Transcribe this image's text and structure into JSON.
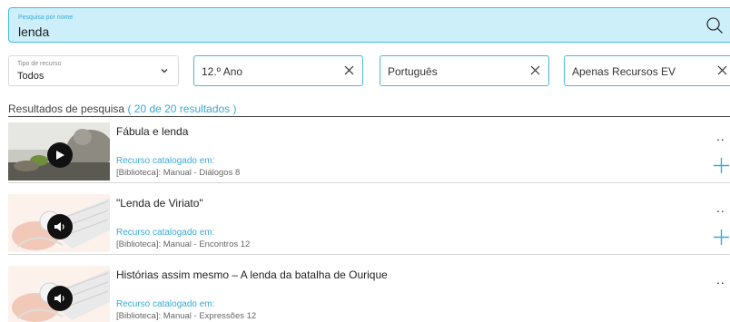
{
  "search": {
    "placeholder_label": "Pesquisa por nome",
    "value": "lenda",
    "icon": "search-icon"
  },
  "filters": {
    "type": {
      "label": "Tipo de recurso",
      "value": "Todos"
    },
    "chips": [
      {
        "label": "12.º Ano"
      },
      {
        "label": "Português"
      },
      {
        "label": "Apenas Recursos EV"
      }
    ]
  },
  "results": {
    "title": "Resultados de pesquisa",
    "count": "( 20 de 20 resultados )",
    "items": [
      {
        "title": "Fábula e lenda",
        "catalog_label": "Recurso catalogado em:",
        "source": "[Biblioteca]: Manual - Diálogos 8",
        "media": "video",
        "more": "..",
        "has_add": true
      },
      {
        "title": "\"Lenda de Viriato\"",
        "catalog_label": "Recurso catalogado em:",
        "source": "[Biblioteca]: Manual - Encontros 12",
        "media": "audio",
        "more": "..",
        "has_add": true
      },
      {
        "title": "Histórias assim mesmo – A lenda da batalha de Ourique",
        "catalog_label": "Recurso catalogado em:",
        "source": "[Biblioteca]: Manual - Expressões 12",
        "media": "audio",
        "more": "..",
        "has_add": false
      }
    ]
  },
  "colors": {
    "accent": "#3aa9d4",
    "search_bg": "#cdeffa",
    "border_accent": "#47b9df"
  }
}
